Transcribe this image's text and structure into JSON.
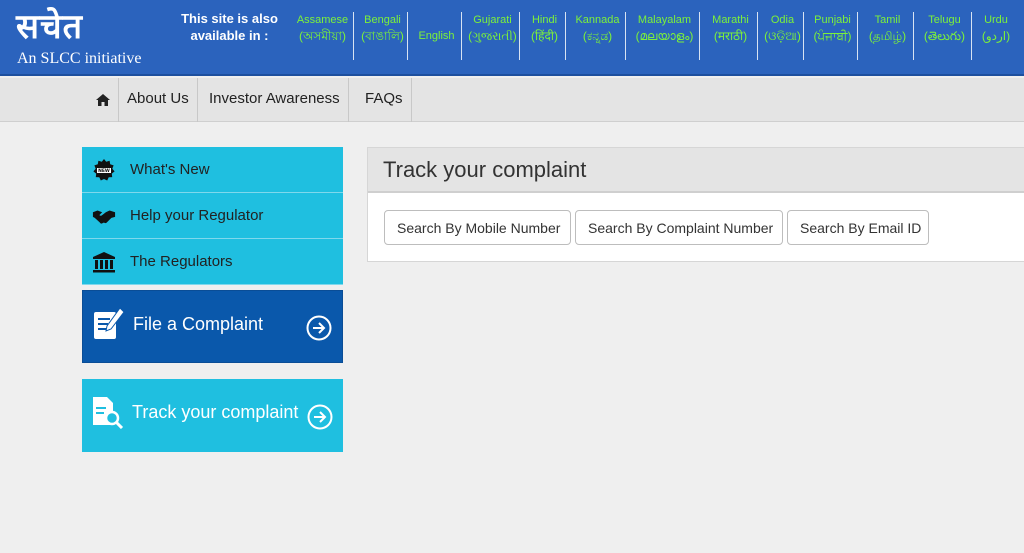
{
  "header": {
    "logo_text": "सचेत",
    "logo_subtitle": "An SLCC initiative",
    "available_line1": "This site is also",
    "available_line2": "available in :",
    "languages": [
      {
        "name": "Assamese",
        "native": "(অসমীয়া)"
      },
      {
        "name": "Bengali",
        "native": "(বাঙালি)"
      },
      {
        "name": "English",
        "native": ""
      },
      {
        "name": "Gujarati",
        "native": "(ગુજરાતી)"
      },
      {
        "name": "Hindi",
        "native": "(हिंदी)"
      },
      {
        "name": "Kannada",
        "native": "(ಕನ್ನಡ)"
      },
      {
        "name": "Malayalam",
        "native": "(മലയാളം)"
      },
      {
        "name": "Marathi",
        "native": "(मराठी)"
      },
      {
        "name": "Odia",
        "native": "(ଓଡ଼ିଆ)"
      },
      {
        "name": "Punjabi",
        "native": "(ਪੰਜਾਬੀ)"
      },
      {
        "name": "Tamil",
        "native": "(தமிழ்)"
      },
      {
        "name": "Telugu",
        "native": "(తెలుగు)"
      },
      {
        "name": "Urdu",
        "native": "(اردو)"
      }
    ]
  },
  "nav": {
    "home_icon": "home-icon",
    "items": [
      "About Us",
      "Investor Awareness",
      "FAQs"
    ]
  },
  "sidebar": {
    "items": [
      {
        "label": "What's New",
        "icon": "new-badge-icon"
      },
      {
        "label": "Help your Regulator",
        "icon": "handshake-icon"
      },
      {
        "label": "The Regulators",
        "icon": "bank-building-icon"
      }
    ],
    "file_complaint_label": "File a Complaint",
    "track_complaint_label": "Track your complaint"
  },
  "panel": {
    "title": "Track your complaint",
    "tabs": [
      "Search By Mobile Number",
      "Search By Complaint Number",
      "Search By Email ID"
    ]
  },
  "colors": {
    "header_bg": "#2b63bd",
    "language_link": "#7cf23a",
    "sidebar_cyan": "#1fbfe0",
    "file_complaint_blue": "#0a58ab"
  }
}
